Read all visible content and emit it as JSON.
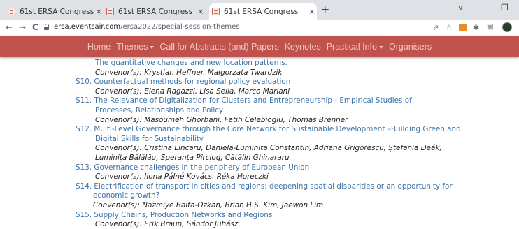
{
  "browser": {
    "tabs": [
      {
        "title": "61st ERSA Congress",
        "close": "×"
      },
      {
        "title": "61st ERSA Congress",
        "close": "×"
      },
      {
        "title": "61st ERSA Congress",
        "close": "×"
      }
    ],
    "new_tab": "+",
    "window_controls": {
      "chevron": "∨",
      "minimize": "–",
      "restore": "❐"
    },
    "nav": {
      "back": "←",
      "forward": "→",
      "reload": "C"
    },
    "url_host": "ersa.eventsair.com",
    "url_path": "/ersa2022/special-session-themes",
    "toolbar_icons": {
      "share": "⇗",
      "star": "☆",
      "puzzle": "✱"
    },
    "accent": "#c0524d"
  },
  "site_nav": [
    {
      "label": "Home"
    },
    {
      "label": "Themes",
      "dropdown": true
    },
    {
      "label": "Call for Abstracts (and) Papers"
    },
    {
      "label": "Keynotes"
    },
    {
      "label": "Practical Info",
      "dropdown": true
    },
    {
      "label": "Organisers"
    }
  ],
  "lines": [
    "The quantitative changes and new location patterns.",
    "Convenor(s): Krystian Heffner, Małgorzata Twardzik",
    "S10. Counterfactual methods for regional policy evaluation",
    "Convenor(s): Elena Ragazzi, Lisa Sella, Marco Mariani",
    "S11. The Relevance of Digitalization for Clusters and Entrepreneurship - Empirical Studies of",
    "Processes, Relationships and Policy",
    "Convenor(s): Masoumeh Ghorbani, Fatih Celebioglu, Thomas Brenner",
    "S12. Multi-Level Governance through the Core Network for Sustainable Development –Building Green and",
    "Digital Skills for Sustainability",
    "Convenor(s): Cristina Lincaru, Daniela-Luminita Constantin, Adriana Grigorescu, Ștefania Deák,",
    "Luminița Bălălău, Speranța Pîrciog, Cătălin Ghinararu",
    "S13. Governance challenges in the periphery of European Union",
    "Convenor(s): Ilona Pálné Kovács, Réka Horeczki",
    "S14. Electrification of transport in cities and regions: deepening spatial disparities or an opportunity for",
    "economic growth?",
    "Convenor(s): Nazmiye Balta-Ozkan, Brian H.S. Kim, Jaewon Lim",
    "S15. Supply Chains, Production Networks and Regions",
    "Convenor(s): Erik Braun, Sándor Juhász"
  ]
}
